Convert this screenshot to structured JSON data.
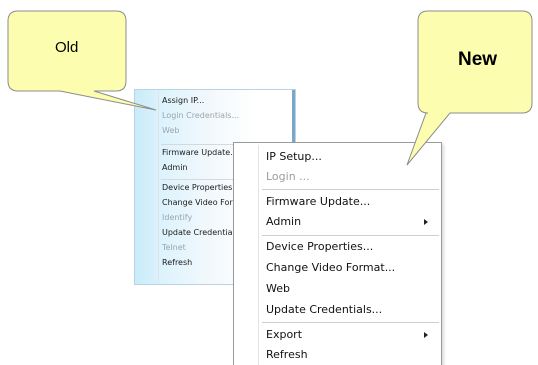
{
  "callouts": {
    "old_label": "Old",
    "new_label": "New",
    "fill_color": "#fdfdb0",
    "stroke_color": "#8c8c8c"
  },
  "old_menu": {
    "items": [
      {
        "label": "Assign IP...",
        "enabled": true
      },
      {
        "label": "Login Credentials...",
        "enabled": false
      },
      {
        "label": "Web",
        "enabled": false
      },
      {
        "label": "Firmware Update...",
        "enabled": true
      },
      {
        "label": "Admin",
        "enabled": true
      },
      {
        "label": "Device Properties...",
        "enabled": true
      },
      {
        "label": "Change Video Format...",
        "enabled": true
      },
      {
        "label": "Identify",
        "enabled": false
      },
      {
        "label": "Update Credentials...",
        "enabled": true
      },
      {
        "label": "Telnet",
        "enabled": false
      },
      {
        "label": "Refresh",
        "enabled": true
      }
    ]
  },
  "new_menu": {
    "items": [
      {
        "label": "IP Setup...",
        "enabled": true,
        "submenu": false
      },
      {
        "label": "Login ...",
        "enabled": false,
        "submenu": false
      },
      {
        "label": "Firmware Update...",
        "enabled": true,
        "submenu": false
      },
      {
        "label": "Admin",
        "enabled": true,
        "submenu": true
      },
      {
        "label": "Device Properties...",
        "enabled": true,
        "submenu": false
      },
      {
        "label": "Change Video Format...",
        "enabled": true,
        "submenu": false
      },
      {
        "label": "Web",
        "enabled": true,
        "submenu": false
      },
      {
        "label": "Update Credentials...",
        "enabled": true,
        "submenu": false
      },
      {
        "label": "Export",
        "enabled": true,
        "submenu": true
      },
      {
        "label": "Refresh",
        "enabled": true,
        "submenu": false
      }
    ]
  }
}
